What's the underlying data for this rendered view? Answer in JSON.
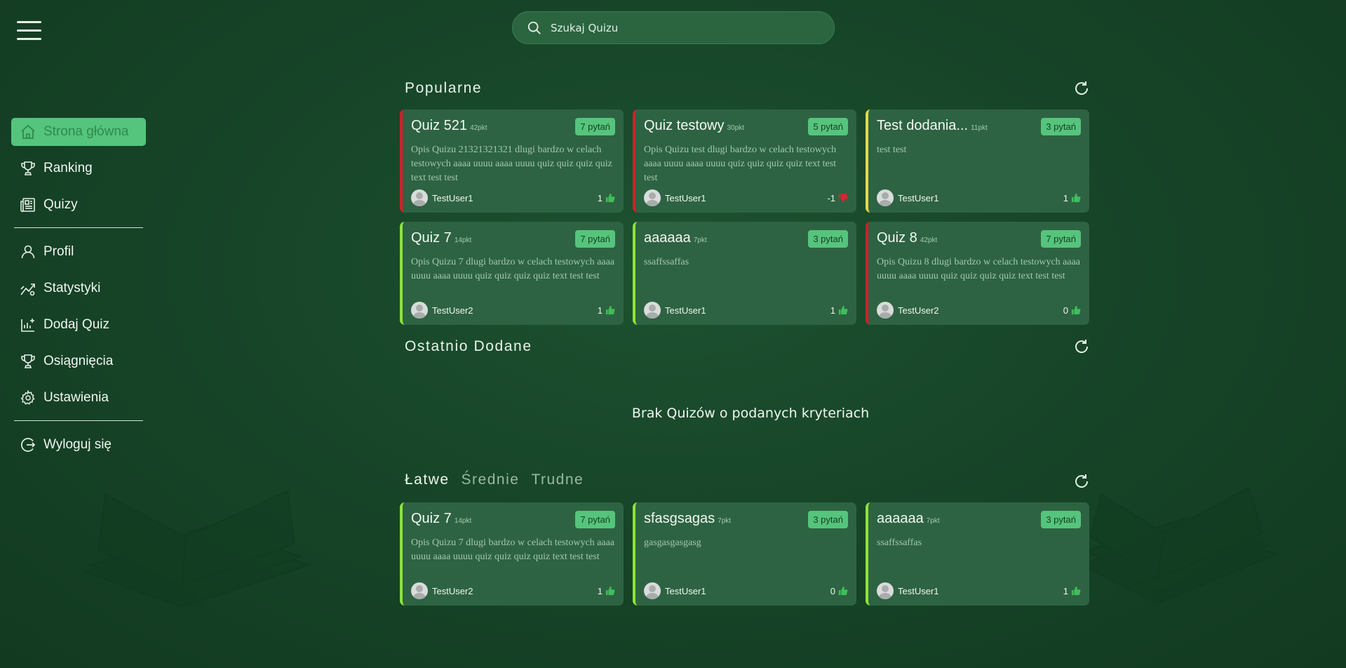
{
  "search": {
    "placeholder": "Szukaj Quizu"
  },
  "sidebar": {
    "items": [
      {
        "label": "Strona główna",
        "icon": "home-icon"
      },
      {
        "label": "Ranking",
        "icon": "trophy-icon"
      },
      {
        "label": "Quizy",
        "icon": "newspaper-icon"
      },
      {
        "label": "Profil",
        "icon": "user-icon"
      },
      {
        "label": "Statystyki",
        "icon": "stats-icon"
      },
      {
        "label": "Dodaj Quiz",
        "icon": "add-chart-icon"
      },
      {
        "label": "Osiągnięcia",
        "icon": "trophy-icon"
      },
      {
        "label": "Ustawienia",
        "icon": "gear-icon"
      },
      {
        "label": "Wyloguj się",
        "icon": "logout-icon"
      }
    ]
  },
  "sections": {
    "popular": "Popularne",
    "recent": "Ostatnio Dodane",
    "recent_empty": "Brak Quizów o podanych kryteriach"
  },
  "difficulty_tabs": [
    "Łatwe",
    "Średnie",
    "Trudne"
  ],
  "popular_cards": [
    {
      "title": "Quiz 521",
      "points": "42pkt",
      "questions": "7 pytań",
      "desc": "Opis Quizu 21321321321 dlugi bardzo w celach testowych aaaa uuuu aaaa uuuu quiz quiz quiz quiz text test test",
      "user": "TestUser1",
      "score": "1",
      "vote": "up"
    },
    {
      "title": "Quiz testowy",
      "points": "30pkt",
      "questions": "5 pytań",
      "desc": "Opis Quizu test dlugi bardzo w celach testowych aaaa uuuu aaaa uuuu quiz quiz quiz quiz text test test",
      "user": "TestUser1",
      "score": "-1",
      "vote": "down"
    },
    {
      "title": "Test dodania...",
      "points": "11pkt",
      "questions": "3 pytań",
      "desc": "test test",
      "user": "TestUser1",
      "score": "1",
      "vote": "up"
    },
    {
      "title": "Quiz 7",
      "points": "14pkt",
      "questions": "7 pytań",
      "desc": "Opis Quizu 7 dlugi bardzo w celach testowych aaaa uuuu aaaa uuuu quiz quiz quiz quiz text test test",
      "user": "TestUser2",
      "score": "1",
      "vote": "up"
    },
    {
      "title": "aaaaaa",
      "points": "7pkt",
      "questions": "3 pytań",
      "desc": "ssaffssaffas",
      "user": "TestUser1",
      "score": "1",
      "vote": "up"
    },
    {
      "title": "Quiz 8",
      "points": "42pkt",
      "questions": "7 pytań",
      "desc": "Opis Quizu 8 dlugi bardzo w celach testowych aaaa uuuu aaaa uuuu quiz quiz quiz quiz text test test",
      "user": "TestUser2",
      "score": "0",
      "vote": "up"
    }
  ],
  "easy_cards": [
    {
      "title": "Quiz 7",
      "points": "14pkt",
      "questions": "7 pytań",
      "desc": "Opis Quizu 7 dlugi bardzo w celach testowych aaaa uuuu aaaa uuuu quiz quiz quiz quiz text test test",
      "user": "TestUser2",
      "score": "1",
      "vote": "up"
    },
    {
      "title": "sfasgsagas",
      "points": "7pkt",
      "questions": "3 pytań",
      "desc": "gasgasgasgasg",
      "user": "TestUser1",
      "score": "0",
      "vote": "up"
    },
    {
      "title": "aaaaaa",
      "points": "7pkt",
      "questions": "3 pytań",
      "desc": "ssaffssaffas",
      "user": "TestUser1",
      "score": "1",
      "vote": "up"
    }
  ],
  "colors": {
    "accent": "#55c47c",
    "card_bg": "#2d6342",
    "border_red": "#d11f2b",
    "border_yellow": "#e5d84a",
    "border_green": "#8ee23a",
    "thumb_up": "#3fbf5a",
    "thumb_down": "#d8262e"
  }
}
